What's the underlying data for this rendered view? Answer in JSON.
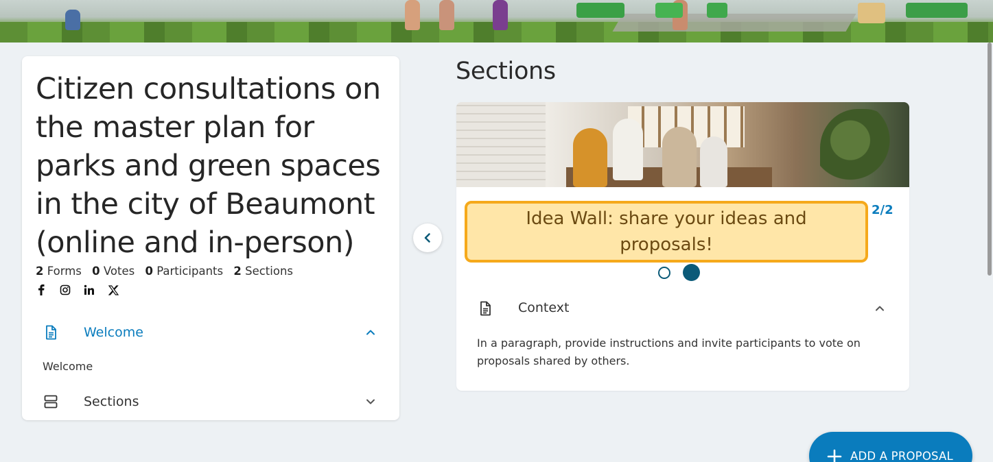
{
  "project": {
    "title": "Citizen consultations on the master plan for parks and green spaces in the city of Beaumont (online and in-person)",
    "stats": [
      {
        "count": "2",
        "label": "Forms"
      },
      {
        "count": "0",
        "label": "Votes"
      },
      {
        "count": "0",
        "label": "Participants"
      },
      {
        "count": "2",
        "label": "Sections"
      }
    ],
    "socials": [
      "facebook-icon",
      "instagram-icon",
      "linkedin-icon",
      "x-icon"
    ]
  },
  "menu": {
    "welcome_label": "Welcome",
    "welcome_content": "Welcome",
    "sections_label": "Sections"
  },
  "sections_panel": {
    "heading": "Sections",
    "slide_title": "Idea Wall: share your ideas and proposals!",
    "counter": "2/2",
    "active_slide": 2,
    "total_slides": 2,
    "context_label": "Context",
    "context_text": "In a paragraph, provide instructions and invite participants to vote on proposals shared by others."
  },
  "actions": {
    "add_proposal_label": "ADD A PROPOSAL"
  },
  "colors": {
    "accent": "#0a7cbd",
    "dot_active": "#0b5a78",
    "highlight_fill": "#ffe6a8",
    "highlight_border": "#f5a91b",
    "background": "#edf1f4"
  }
}
